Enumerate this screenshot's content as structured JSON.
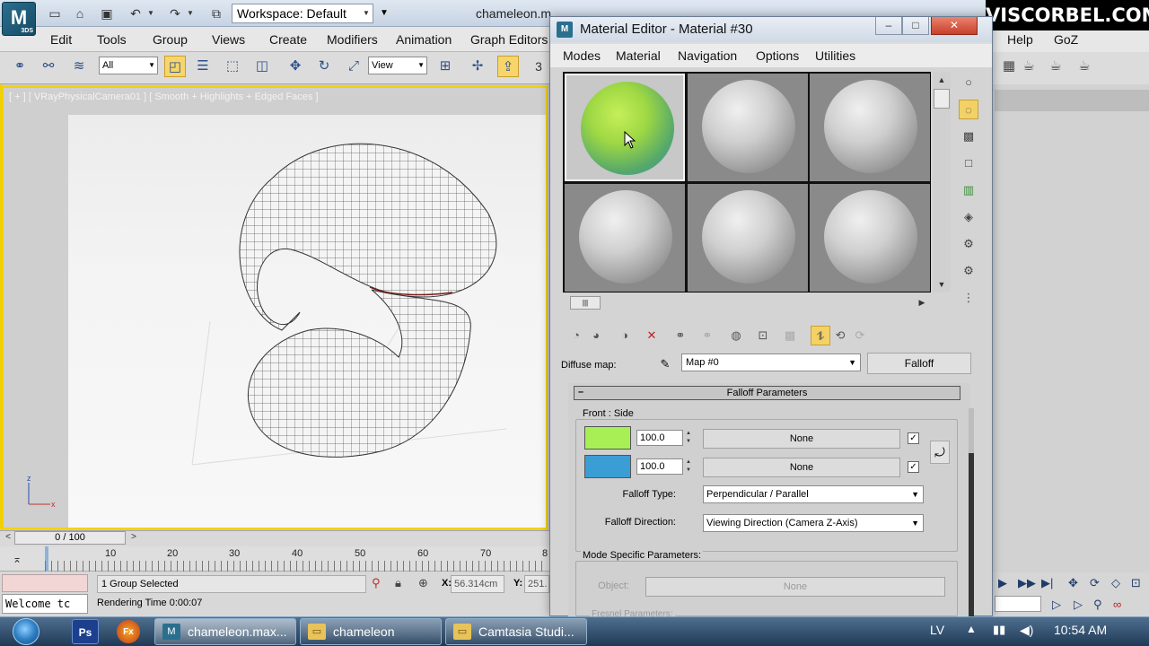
{
  "max": {
    "quick_access": {
      "workspace_value": "Workspace: Default",
      "doc_title": "chameleon.m"
    },
    "menu": [
      "Edit",
      "Tools",
      "Group",
      "Views",
      "Create",
      "Modifiers",
      "Animation",
      "Graph Editors"
    ],
    "menu_right": [
      "Help",
      "GoZ"
    ],
    "toolbar": {
      "selection_filter": "All",
      "ref_coord": "View",
      "snap_number": "3"
    },
    "viewport_label": "[ + ] [ VRayPhysicalCamera01 ] [ Smooth + Highlights + Edged Faces ]",
    "axis": {
      "z": "z",
      "x": "x"
    },
    "time_slider": {
      "frame": "0 / 100",
      "prev": "<",
      "next": ">"
    },
    "timeline_ticks": [
      "0",
      "10",
      "20",
      "30",
      "40",
      "50",
      "60",
      "70",
      "8"
    ],
    "status": {
      "maxscript": "Welcome tc",
      "selection": "1 Group Selected",
      "render_time": "Rendering Time  0:00:07",
      "x_label": "X:",
      "x_value": "56.314cm",
      "y_label": "Y:",
      "y_value": "251."
    }
  },
  "material_editor": {
    "title": "Material Editor - Material #30",
    "title_icon": "M",
    "window_buttons": {
      "minimize": "–",
      "maximize": "□",
      "close": "✕"
    },
    "menu": [
      "Modes",
      "Material",
      "Navigation",
      "Options",
      "Utilities"
    ],
    "diffuse_label": "Diffuse map:",
    "map_name": "Map #0",
    "map_type": "Falloff",
    "rollout_title": "Falloff Parameters",
    "rollout_toggle": "–",
    "front_side": {
      "title": "Front : Side",
      "color1": "#a8ef55",
      "color2": "#3a9ed4",
      "value1": "100.0",
      "value2": "100.0",
      "map1": "None",
      "map2": "None"
    },
    "falloff_type_label": "Falloff Type:",
    "falloff_type_value": "Perpendicular / Parallel",
    "falloff_direction_label": "Falloff Direction:",
    "falloff_direction_value": "Viewing Direction (Camera Z-Axis)",
    "mode_specific_title": "Mode Specific Parameters:",
    "object_label": "Object:",
    "object_value": "None",
    "fresnel_title": "Fresnel Parameters:"
  },
  "watermark": "VISCORBEL.COM",
  "taskbar": {
    "tasks": [
      {
        "label": "chameleon.max...",
        "icon": "M"
      },
      {
        "label": "chameleon",
        "icon": ""
      },
      {
        "label": "Camtasia Studi...",
        "icon": ""
      }
    ],
    "pinned": [
      "Ps",
      "Fx"
    ],
    "language": "LV",
    "clock": "10:54 AM"
  },
  "colors": {
    "selection_yellow": "#f2d200",
    "close_red": "#c7402a",
    "front_green": "#a8ef55",
    "side_blue": "#3a9ed4"
  }
}
